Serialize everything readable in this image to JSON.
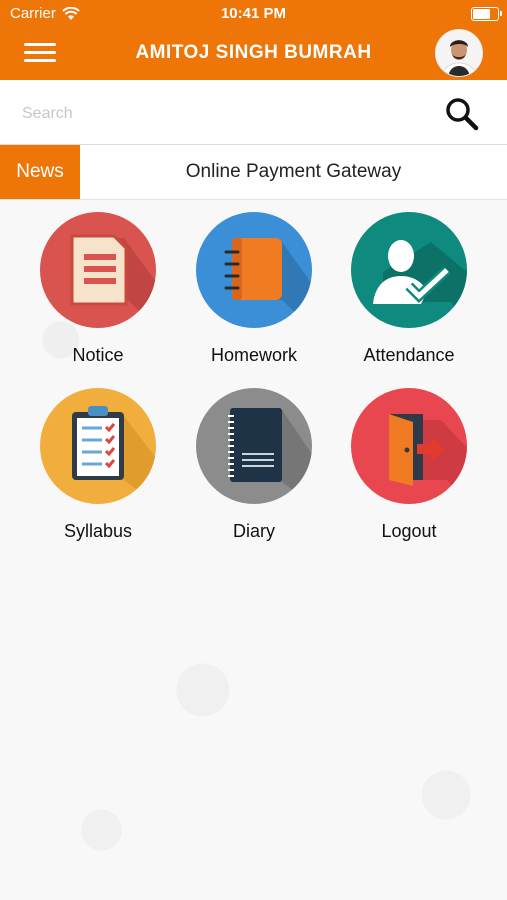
{
  "status_bar": {
    "carrier": "Carrier",
    "time": "10:41 PM"
  },
  "header": {
    "title": "AMITOJ SINGH BUMRAH"
  },
  "search": {
    "placeholder": "Search"
  },
  "news": {
    "badge": "News",
    "headline": "Online Payment Gateway"
  },
  "menu": [
    {
      "label": "Notice",
      "icon": "notice-icon",
      "color": "#d9534f"
    },
    {
      "label": "Homework",
      "icon": "notebook-icon",
      "color": "#3a8fd6"
    },
    {
      "label": "Attendance",
      "icon": "attendance-icon",
      "color": "#0f8a7e"
    },
    {
      "label": "Syllabus",
      "icon": "checklist-icon",
      "color": "#f2ae3d"
    },
    {
      "label": "Diary",
      "icon": "diary-icon",
      "color": "#8c8c8c"
    },
    {
      "label": "Logout",
      "icon": "logout-icon",
      "color": "#e8474f"
    }
  ],
  "colors": {
    "brand": "#ee7608"
  }
}
